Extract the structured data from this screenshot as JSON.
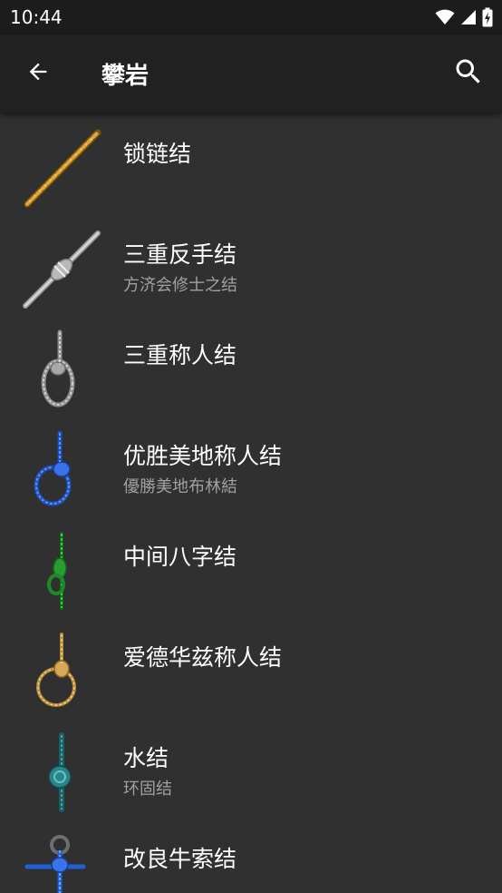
{
  "status_bar": {
    "time": "10:44"
  },
  "app_bar": {
    "title": "攀岩"
  },
  "items": [
    {
      "title": "锁链结",
      "subtitle": ""
    },
    {
      "title": "三重反手结",
      "subtitle": "方济会修士之结"
    },
    {
      "title": "三重称人结",
      "subtitle": ""
    },
    {
      "title": "优胜美地称人结",
      "subtitle": "優勝美地布林結"
    },
    {
      "title": "中间八字结",
      "subtitle": ""
    },
    {
      "title": "爱德华兹称人结",
      "subtitle": ""
    },
    {
      "title": "水结",
      "subtitle": "环固结"
    },
    {
      "title": "改良牛索结",
      "subtitle": ""
    }
  ]
}
